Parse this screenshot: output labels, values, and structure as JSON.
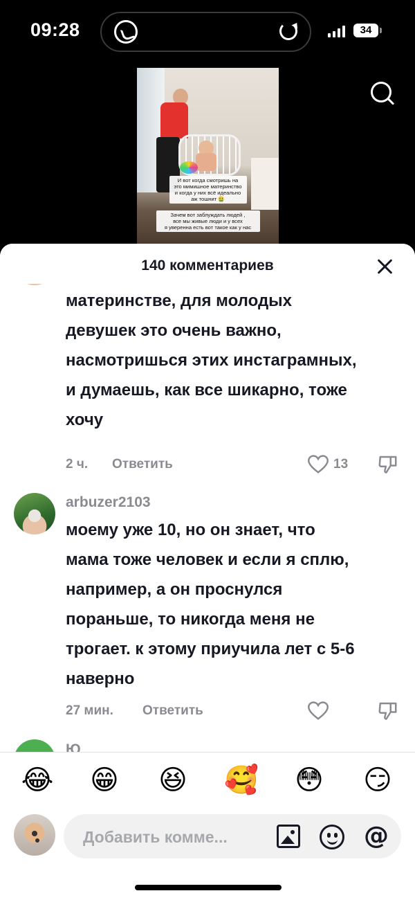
{
  "status_bar": {
    "time": "09:28",
    "battery": "34",
    "icons": [
      "whatsapp-icon",
      "screen-rotation-icon",
      "signal-icon",
      "battery-icon"
    ]
  },
  "video": {
    "caption_1": "И вот когда смотришь на\nэто мимишное материнство\nи когда у них всё идеально\nаж тошнит 🤮",
    "caption_2": "Зачем вот заблуждать людей ,\nвсе мы живые люди и у всех\nя уверенна есть вот такое как у нас",
    "icons": [
      "search-icon"
    ]
  },
  "sheet": {
    "title": "140 комментариев",
    "close_icon": "close-icon"
  },
  "comments": [
    {
      "text": "спасибо вам за правду о\nматеринстве, для молодых\nдевушек это очень важно,\nнасмотришься этих инстаграмных,\nи думаешь, как все шикарно, тоже\nхочу",
      "time": "2 ч.",
      "reply": "Ответить",
      "likes": "13"
    },
    {
      "username": "arbuzer2103",
      "text": "моему уже 10, но он знает, что\nмама тоже человек и если я сплю,\nнапример, а он проснулся\nпораньше, то никогда меня не\nтрогает. к этому приучила лет с 5-6\nнаверно",
      "time": "27 мин.",
      "reply": "Ответить",
      "likes": ""
    },
    {
      "username": "Ю"
    }
  ],
  "emoji_bar": [
    "😂",
    "😁",
    "😆",
    "🥰",
    "😳",
    "😏"
  ],
  "input": {
    "placeholder": "Добавить комме...",
    "icons": [
      "image-icon",
      "emoji-icon",
      "mention-icon"
    ],
    "mention_symbol": "@"
  }
}
